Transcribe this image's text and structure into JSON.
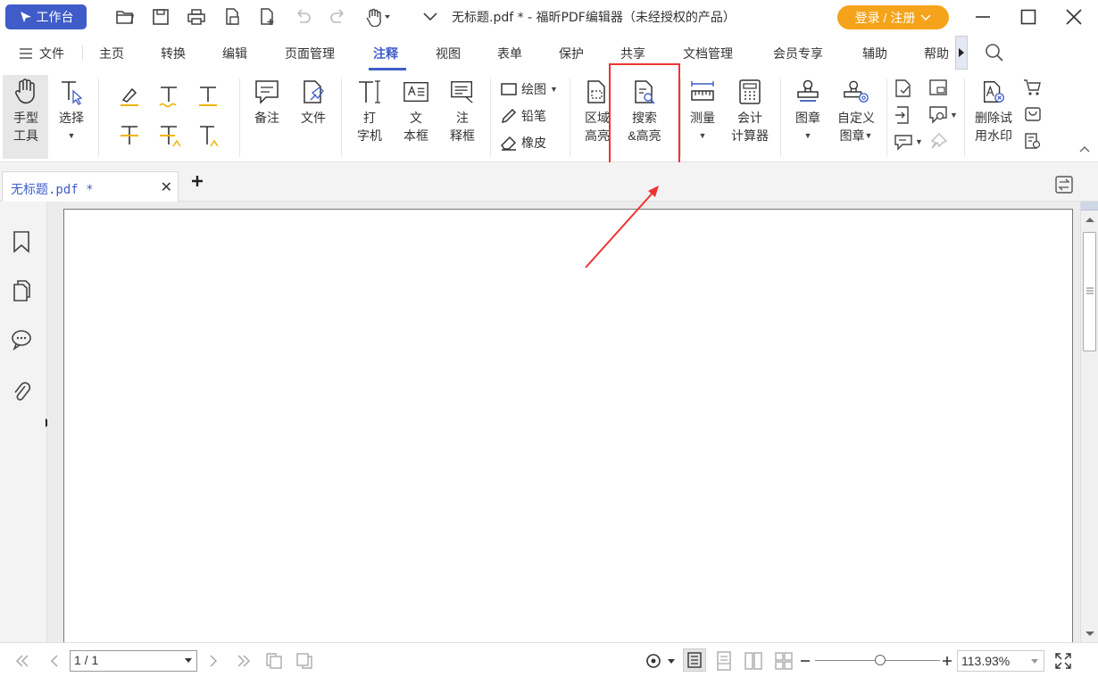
{
  "titlebar": {
    "workbench_label": "工作台",
    "title": "无标题.pdf * - 福昕PDF编辑器（未经授权的产品）",
    "login_label": "登录 / 注册"
  },
  "menu": {
    "file_label": "文件",
    "tabs": [
      "主页",
      "转换",
      "编辑",
      "页面管理",
      "注释",
      "视图",
      "表单",
      "保护",
      "共享",
      "文档管理",
      "会员专享",
      "辅助",
      "帮助"
    ],
    "active_tab": "注释"
  },
  "ribbon": {
    "hand_tool": [
      "手型",
      "工具"
    ],
    "select": "选择",
    "note": "备注",
    "file": "文件",
    "typewriter": [
      "打",
      "字机"
    ],
    "textbox": [
      "文",
      "本框"
    ],
    "callout": [
      "注",
      "释框"
    ],
    "draw": "绘图",
    "pencil": "铅笔",
    "eraser": "橡皮",
    "area_highlight": [
      "区域",
      "高亮"
    ],
    "search_highlight": [
      "搜索",
      "&高亮"
    ],
    "measure": "测量",
    "calculator": [
      "会计",
      "计算器"
    ],
    "stamp": "图章",
    "custom_stamp": [
      "自定义",
      "图章"
    ],
    "remove_watermark": [
      "删除试",
      "用水印"
    ]
  },
  "doc_tab": {
    "label": "无标题.pdf *"
  },
  "statusbar": {
    "page_value": "1 / 1",
    "zoom_value": "113.93%"
  },
  "colors": {
    "accent": "#3f5cc8",
    "login": "#f4a31a",
    "highlight_box": "#e33333",
    "arrow": "#e33333"
  }
}
